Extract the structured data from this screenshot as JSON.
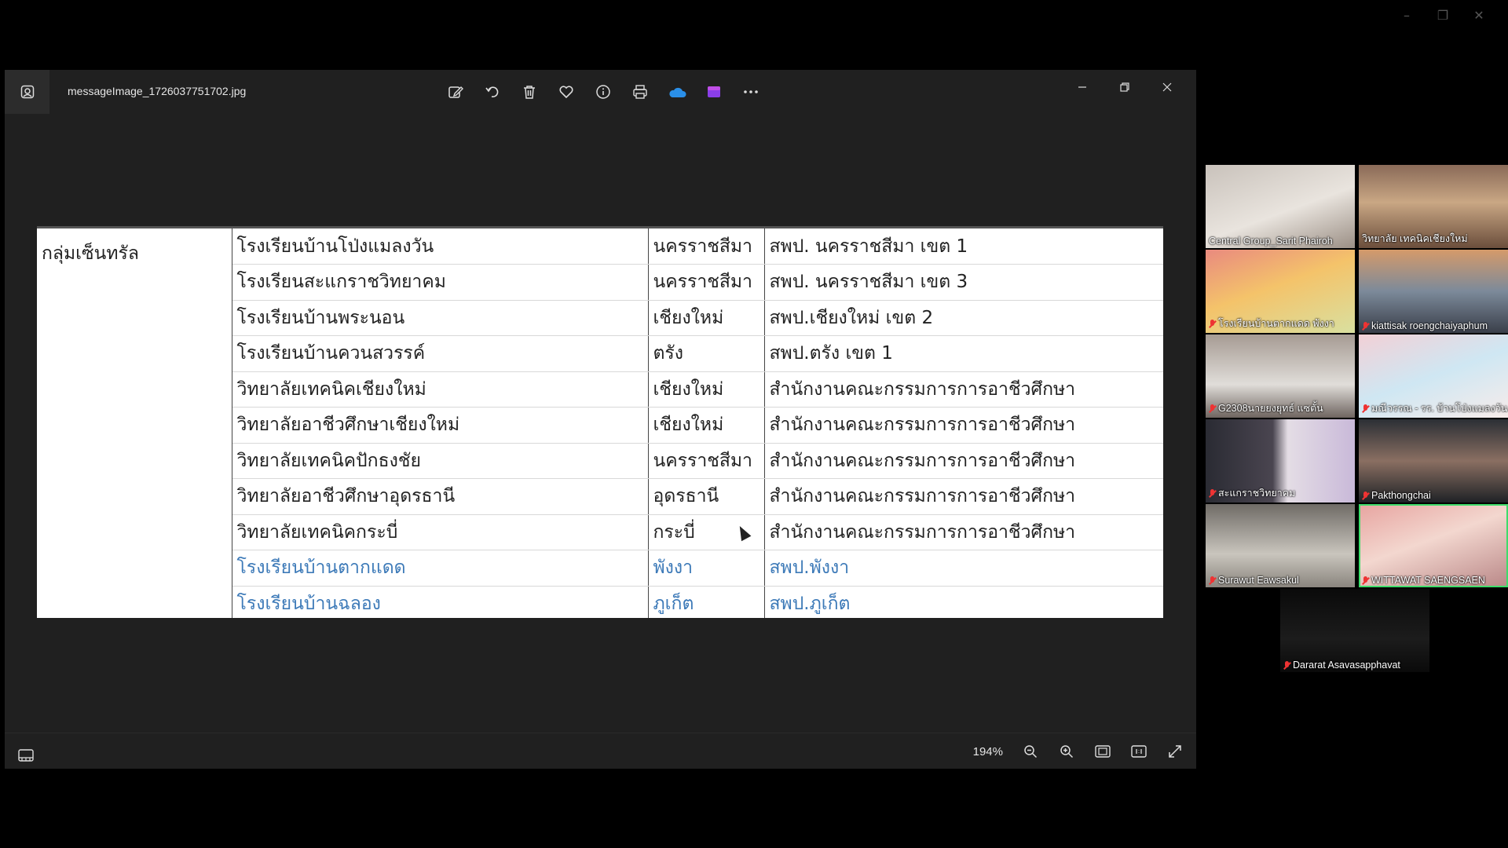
{
  "viewer": {
    "filename": "messageImage_1726037751702.jpg",
    "zoom": "194%"
  },
  "toolbar_icons": [
    "edit-icon",
    "rotate-icon",
    "delete-icon",
    "favorite-icon",
    "info-icon",
    "print-icon",
    "onedrive-icon",
    "clipchamp-icon",
    "more-icon"
  ],
  "table": {
    "group": "กลุ่มเซ็นทรัล",
    "rows": [
      {
        "school": "โรงเรียนบ้านโป่งแมลงวัน",
        "province": "นครราชสีมา",
        "office": "สพป. นครราชสีมา เขต 1"
      },
      {
        "school": "โรงเรียนสะแกราชวิทยาคม",
        "province": "นครราชสีมา",
        "office": "สพป. นครราชสีมา เขต 3"
      },
      {
        "school": "โรงเรียนบ้านพระนอน",
        "province": "เชียงใหม่",
        "office": "สพป.เชียงใหม่ เขต 2"
      },
      {
        "school": "โรงเรียนบ้านควนสวรรค์",
        "province": "ตรัง",
        "office": "สพป.ตรัง เขต 1"
      },
      {
        "school": "วิทยาลัยเทคนิคเชียงใหม่",
        "province": "เชียงใหม่",
        "office": "สำนักงานคณะกรรมการการอาชีวศึกษา"
      },
      {
        "school": "วิทยาลัยอาชีวศึกษาเชียงใหม่",
        "province": "เชียงใหม่",
        "office": "สำนักงานคณะกรรมการการอาชีวศึกษา"
      },
      {
        "school": "วิทยาลัยเทคนิคปักธงชัย",
        "province": "นครราชสีมา",
        "office": "สำนักงานคณะกรรมการการอาชีวศึกษา"
      },
      {
        "school": "วิทยาลัยอาชีวศึกษาอุดรธานี",
        "province": "อุดรธานี",
        "office": "สำนักงานคณะกรรมการการอาชีวศึกษา"
      },
      {
        "school": "วิทยาลัยเทคนิคกระบี่",
        "province": "กระบี่",
        "office": "สำนักงานคณะกรรมการการอาชีวศึกษา"
      },
      {
        "school": "โรงเรียนบ้านตากแดด",
        "province": "พังงา",
        "office": "สพป.พังงา"
      },
      {
        "school": "โรงเรียนบ้านฉลอง",
        "province": "ภูเก็ต",
        "office": "สพป.ภูเก็ต"
      }
    ]
  },
  "participants": [
    {
      "name": "Central Group_Sarit Phairoh"
    },
    {
      "name": "วิทยาลัย เทคนิคเชียงใหม่"
    },
    {
      "name": "โรงเรียนบ้านตากแดด พังงา"
    },
    {
      "name": "kiattisak roengchaiyaphum"
    },
    {
      "name": "G2308นายยงยุทธ์ แซตั้น"
    },
    {
      "name": "มณีวรรณ - รร. บ้านโป่งแมลงวัน"
    },
    {
      "name": "สะแกราชวิทยาคม"
    },
    {
      "name": "Pakthongchai"
    },
    {
      "name": "Surawut Eawsakul"
    },
    {
      "name": "WITTAWAT SAENGSAEN"
    },
    {
      "name": "Dararat Asavasapphavat"
    }
  ]
}
